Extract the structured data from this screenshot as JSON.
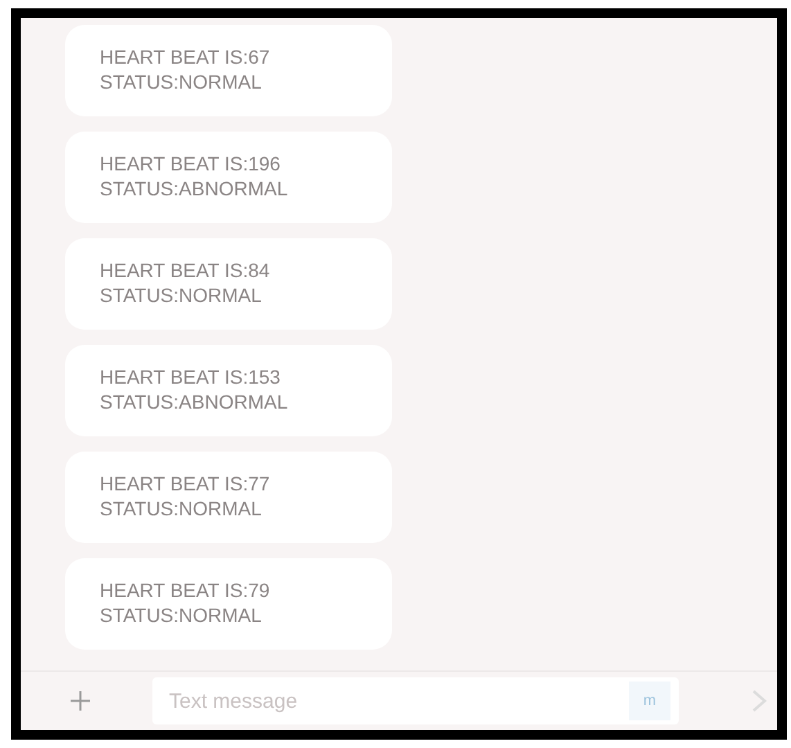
{
  "messages": [
    {
      "heart_beat": "HEART BEAT IS:67",
      "status": "STATUS:NORMAL"
    },
    {
      "heart_beat": "HEART BEAT IS:196",
      "status": "STATUS:ABNORMAL"
    },
    {
      "heart_beat": "HEART BEAT IS:84",
      "status": "STATUS:NORMAL"
    },
    {
      "heart_beat": "HEART BEAT IS:153",
      "status": "STATUS:ABNORMAL"
    },
    {
      "heart_beat": "HEART BEAT IS:77",
      "status": "STATUS:NORMAL"
    },
    {
      "heart_beat": "HEART BEAT IS:79",
      "status": "STATUS:NORMAL"
    }
  ],
  "composer": {
    "placeholder": "Text message",
    "sim_badge": "m"
  }
}
